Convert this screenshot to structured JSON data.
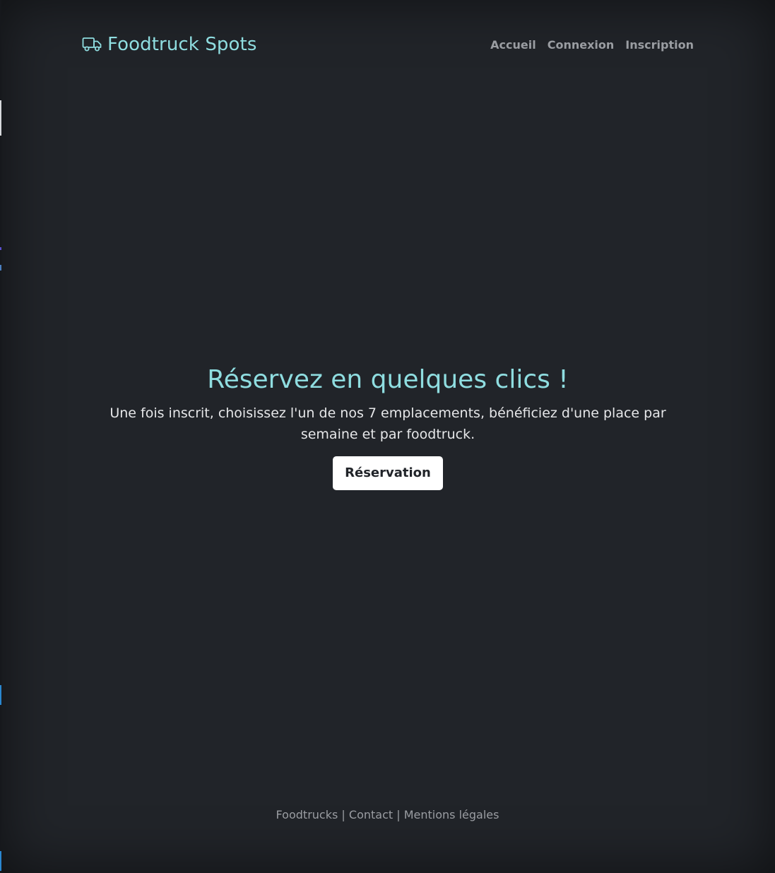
{
  "header": {
    "brand_name": "Foodtruck Spots",
    "nav": [
      {
        "label": "Accueil"
      },
      {
        "label": "Connexion"
      },
      {
        "label": "Inscription"
      }
    ]
  },
  "hero": {
    "title": "Réservez en quelques clics !",
    "description": "Une fois inscrit, choisissez l'un de nos 7 emplacements, bénéficiez d'une place par semaine et par foodtruck.",
    "button_label": "Réservation"
  },
  "footer": {
    "links": [
      {
        "label": "Foodtrucks"
      },
      {
        "label": "Contact"
      },
      {
        "label": "Mentions légales"
      }
    ],
    "separator": "|"
  },
  "colors": {
    "background": "#212429",
    "accent": "#8fdde0",
    "nav_text": "#9a9da2",
    "body_text": "#e6e7e9",
    "button_bg": "#ffffff"
  },
  "icons": {
    "brand_icon": "truck-icon"
  }
}
